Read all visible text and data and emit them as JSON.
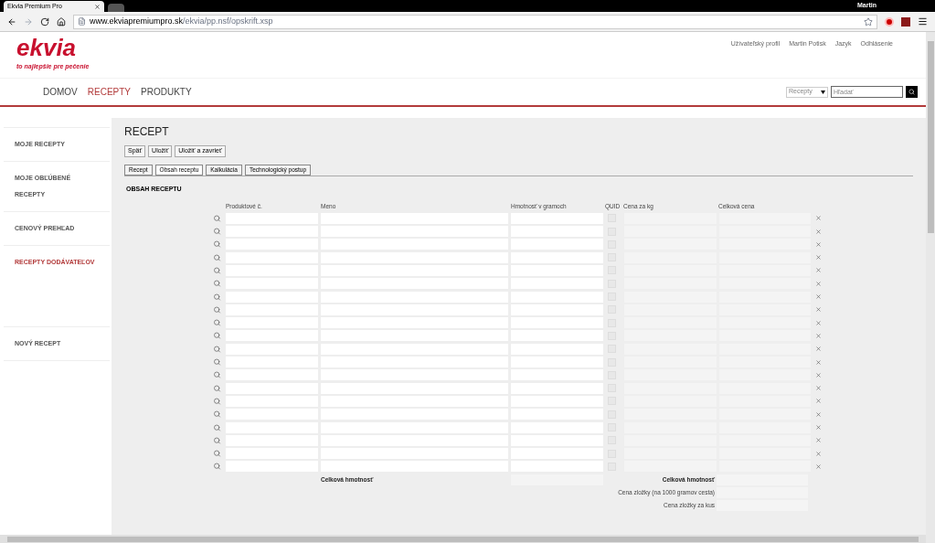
{
  "browser": {
    "tab_title": "Ekvia Premium Pro",
    "user": "Martin",
    "url_host": "www.ekviapremiumpro.sk",
    "url_path": "/ekvia/pp.nsf/opskrift.xsp"
  },
  "header": {
    "logo": "ekvia",
    "tagline": "to najlepšie pre pečenie",
    "links": [
      "Užívateľský profil",
      "Martin Potisk",
      "Jazyk",
      "Odhlásenie"
    ]
  },
  "nav": [
    {
      "label": "DOMOV",
      "selected": false
    },
    {
      "label": "RECEPTY",
      "selected": true
    },
    {
      "label": "PRODUKTY",
      "selected": false
    }
  ],
  "search": {
    "scope": "Recepty",
    "placeholder": "Hľadať"
  },
  "sidebar": [
    {
      "label": "MOJE RECEPTY",
      "selected": false
    },
    {
      "label": "MOJE OBĽÚBENÉ RECEPTY",
      "selected": false
    },
    {
      "label": "CENOVÝ PREHĽAD",
      "selected": false
    },
    {
      "label": "RECEPTY DODÁVATEĽOV",
      "selected": true
    },
    {
      "label": "NOVÝ RECEPT",
      "selected": false
    }
  ],
  "page_title": "RECEPT",
  "buttons": [
    "Späť",
    "Uložiť",
    "Uložiť a zavrieť"
  ],
  "tabs": [
    {
      "label": "Recept",
      "selected": false
    },
    {
      "label": "Obsah receptu",
      "selected": true
    },
    {
      "label": "Kalkulácia",
      "selected": false
    },
    {
      "label": "Technologický postup",
      "selected": false
    }
  ],
  "section_title": "OBSAH RECEPTU",
  "columns": [
    "Produktové č.",
    "Meno",
    "Hmotnosť v gramoch",
    "QUID",
    "Cena za kg",
    "Celková cena"
  ],
  "rows": [
    {
      "checked": false
    },
    {
      "checked": false
    },
    {
      "checked": false
    },
    {
      "checked": false
    },
    {
      "checked": false
    },
    {
      "checked": false
    },
    {
      "checked": false
    },
    {
      "checked": false
    },
    {
      "checked": false
    },
    {
      "checked": false
    },
    {
      "checked": false
    },
    {
      "checked": false
    },
    {
      "checked": false
    },
    {
      "checked": false
    },
    {
      "checked": false
    },
    {
      "checked": false
    },
    {
      "checked": false
    },
    {
      "checked": false
    },
    {
      "checked": false
    },
    {
      "checked": false
    }
  ],
  "totals": {
    "weight_label": "Celková hmotnosť",
    "price_label": "Celková hmotnosť",
    "per_1000_label": "Cena zložky (na 1000 gramov cesta)",
    "per_piece_label": "Cena zložky za kus"
  }
}
